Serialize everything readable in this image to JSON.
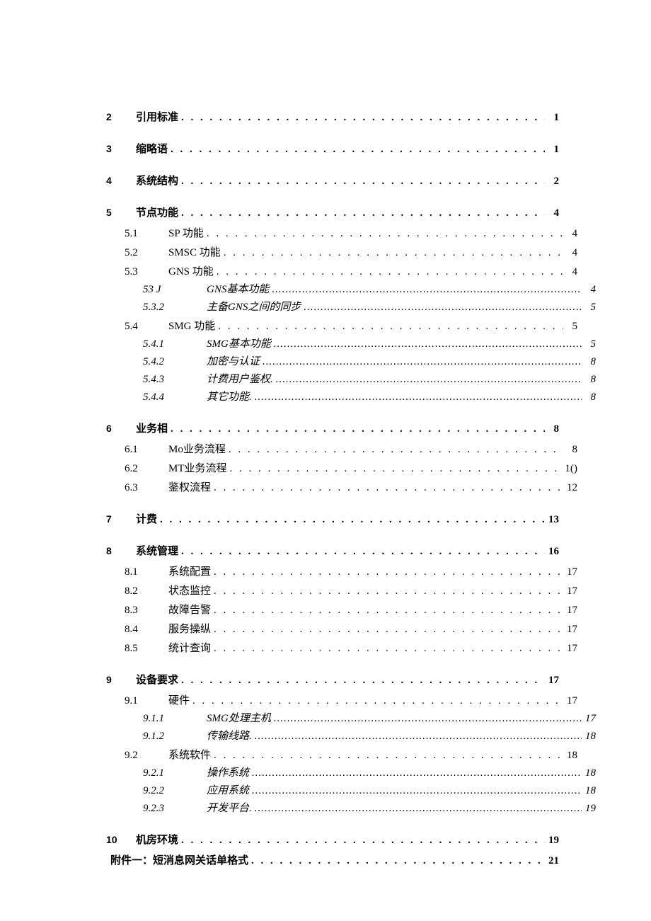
{
  "toc": {
    "entries": [
      {
        "level": 1,
        "num": "2",
        "title": "引用标准",
        "page": "1",
        "leader": "dots"
      },
      {
        "level": 1,
        "num": "3",
        "title": "缩略语",
        "page": "1",
        "leader": "dots"
      },
      {
        "level": 1,
        "num": "4",
        "title": "系统结构",
        "page": "2",
        "leader": "dots"
      },
      {
        "level": 1,
        "num": "5",
        "title": "节点功能",
        "page": "4",
        "leader": "dots"
      },
      {
        "level": 2,
        "num": "5.1",
        "title": "SP 功能",
        "page": "4",
        "leader": "dots"
      },
      {
        "level": 2,
        "num": "5.2",
        "title": "SMSC 功能",
        "page": "4",
        "leader": "dots"
      },
      {
        "level": 2,
        "num": "5.3",
        "title": "GNS 功能",
        "page": "4",
        "leader": "dots"
      },
      {
        "level": 3,
        "num": "53 J",
        "title": "GNS基本功能",
        "page": "4",
        "leader": "tight"
      },
      {
        "level": 3,
        "num": "5.3.2",
        "title": "主备GNS之间的同步",
        "page": "5",
        "leader": "tight"
      },
      {
        "level": 2,
        "num": "5.4",
        "title": "SMG 功能",
        "page": "5",
        "leader": "dots"
      },
      {
        "level": 3,
        "num": "5.4.1",
        "title": "SMG基本功能",
        "page": "5",
        "leader": "tight"
      },
      {
        "level": 3,
        "num": "5.4.2",
        "title": "加密与认证",
        "page": "8",
        "leader": "tight"
      },
      {
        "level": 3,
        "num": "5.4.3",
        "title": "计费用户鉴权.",
        "page": "8",
        "leader": "tight"
      },
      {
        "level": 3,
        "num": "5.4.4",
        "title": "其它功能.",
        "page": "8",
        "leader": "tight"
      },
      {
        "level": 1,
        "num": "6",
        "title": "业务相",
        "page": "8",
        "leader": "dots"
      },
      {
        "level": 2,
        "num": "6.1",
        "title": "Mo业务流程",
        "page": "8",
        "leader": "dots"
      },
      {
        "level": 2,
        "num": "6.2",
        "title": "MT业务流程",
        "page": "1()",
        "leader": "dots"
      },
      {
        "level": 2,
        "num": "6.3",
        "title": "鉴权流程",
        "page": "12",
        "leader": "dots"
      },
      {
        "level": 1,
        "num": "7",
        "title": "计费",
        "page": "13",
        "leader": "dots"
      },
      {
        "level": 1,
        "num": "8",
        "title": "系统管理",
        "page": "16",
        "leader": "dots"
      },
      {
        "level": 2,
        "num": "8.1",
        "title": "系统配置",
        "page": "17",
        "leader": "dots"
      },
      {
        "level": 2,
        "num": "8.2",
        "title": "状态监控",
        "page": "17",
        "leader": "dots"
      },
      {
        "level": 2,
        "num": "8.3",
        "title": "故障告警",
        "page": "17",
        "leader": "dots"
      },
      {
        "level": 2,
        "num": "8.4",
        "title": "服务操纵",
        "page": "17",
        "leader": "dots"
      },
      {
        "level": 2,
        "num": "8.5",
        "title": "统计查询",
        "page": "17",
        "leader": "dots"
      },
      {
        "level": 1,
        "num": "9",
        "title": "设备要求",
        "page": "17",
        "leader": "dots"
      },
      {
        "level": 2,
        "num": "9.1",
        "title": "硬件",
        "page": "17",
        "leader": "dots"
      },
      {
        "level": 3,
        "num": "9.1.1",
        "title": "SMG处理主机",
        "page": "17",
        "leader": "tight"
      },
      {
        "level": 3,
        "num": "9.1.2",
        "title": "传输线路.",
        "page": "18",
        "leader": "tight"
      },
      {
        "level": 2,
        "num": "9.2",
        "title": "系统软件",
        "page": "18",
        "leader": "dots"
      },
      {
        "level": 3,
        "num": "9.2.1",
        "title": "操作系统",
        "page": "18",
        "leader": "tight"
      },
      {
        "level": 3,
        "num": "9.2.2",
        "title": "应用系统",
        "page": "18",
        "leader": "tight"
      },
      {
        "level": 3,
        "num": "9.2.3",
        "title": "开发平台.",
        "page": "19",
        "leader": "tight"
      },
      {
        "level": 1,
        "num": "10",
        "title": "机房环境",
        "page": "19",
        "leader": "dots"
      },
      {
        "level": 0,
        "num": "",
        "title": "附件一：短消息网关话单格式",
        "page": "21",
        "leader": "dots"
      }
    ]
  }
}
